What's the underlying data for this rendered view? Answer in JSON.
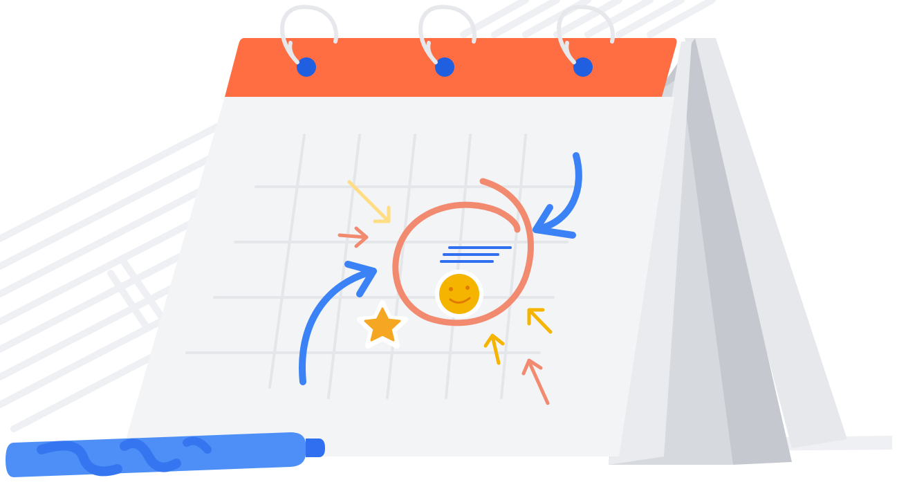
{
  "illustration": {
    "subject": "desk-calendar-with-marker",
    "colors": {
      "background": "#ffffff",
      "stripes": "#eef0f3",
      "header": "#ff6d42",
      "ring_hole": "#1f5fe0",
      "ring_wire": "#e6e8ec",
      "page": "#f3f4f6",
      "grid": "#e4e6ea",
      "stand_light": "#e9ebee",
      "stand_mid": "#d6d9de",
      "stand_dark": "#c5c9cf",
      "circle_mark": "#f28a70",
      "arrow_blue": "#3b82f6",
      "arrow_yellow_light": "#ffdd85",
      "arrow_yellow": "#f5b400",
      "arrow_salmon": "#f28a70",
      "star": "#f5a623",
      "smiley": "#f5b400",
      "event_lines": "#2f6ff0",
      "marker_body": "#4d8ff7",
      "marker_stripes": "#3576f0",
      "marker_tip": "#2f6ff0"
    },
    "icons": [
      "calendar-icon",
      "smiley-sticker-icon",
      "star-sticker-icon",
      "marker-pen-icon"
    ]
  }
}
